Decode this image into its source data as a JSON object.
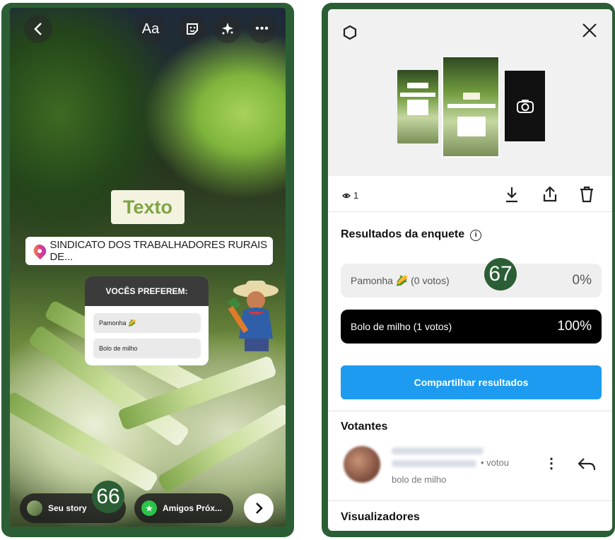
{
  "left_panel": {
    "top_bar": {
      "back_icon": "chevron-left-icon",
      "text_tool_label": "Aa",
      "sticker_icon": "sticker-icon",
      "effects_icon": "sparkles-icon",
      "more_icon": "more-icon"
    },
    "stickers": {
      "text_sticker": "Texto",
      "location_sticker": "SINDICATO DOS TRABALHADORES RURAIS DE...",
      "poll": {
        "question": "VOCÊS PREFEREM:",
        "options": [
          "Pamonha 🌽",
          "Bolo de milho"
        ]
      }
    },
    "bottom_bar": {
      "your_story_label": "Seu story",
      "close_friends_label": "Amigos Próx...",
      "next_icon": "chevron-right-icon"
    },
    "step_number": "66"
  },
  "right_panel": {
    "close_icon": "close-icon",
    "view_count": "1",
    "actions": [
      "download-icon",
      "share-icon",
      "trash-icon"
    ],
    "section_title": "Resultados da enquete",
    "step_number": "67",
    "results": [
      {
        "label": "Pamonha 🌽 (0 votos)",
        "percent": "0%",
        "fraction": 0
      },
      {
        "label": "Bolo de milho (1 votos)",
        "percent": "100%",
        "fraction": 1
      }
    ],
    "share_button_label": "Compartilhar resultados",
    "voters_title": "Votantes",
    "voter": {
      "voted_text": "• votou",
      "choice": "bolo de milho"
    },
    "viewers_title": "Visualizadores"
  }
}
